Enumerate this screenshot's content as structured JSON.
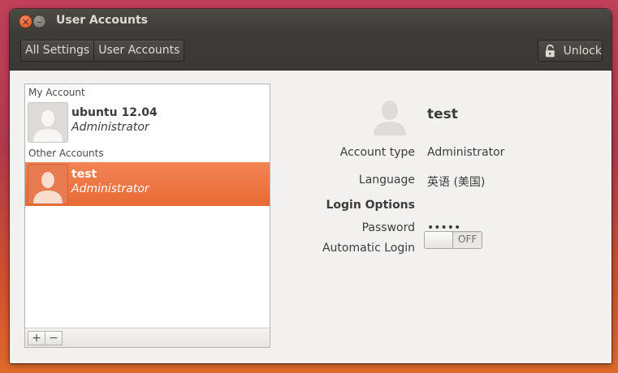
{
  "window": {
    "title": "User Accounts",
    "close_glyph": "×",
    "minimize_glyph": "–"
  },
  "toolbar": {
    "breadcrumbs": [
      {
        "label": "All Settings"
      },
      {
        "label": "User Accounts"
      }
    ],
    "unlock_label": "Unlock",
    "unlock_icon": "padlock-open-icon"
  },
  "sidebar": {
    "my_account_label": "My Account",
    "other_accounts_label": "Other Accounts",
    "accounts": [
      {
        "name": "ubuntu 12.04",
        "role": "Administrator",
        "selected": false
      },
      {
        "name": "test",
        "role": "Administrator",
        "selected": true
      }
    ],
    "add_glyph": "+",
    "remove_glyph": "−"
  },
  "details": {
    "name": "test",
    "fields": [
      {
        "label": "Account type",
        "value": "Administrator"
      },
      {
        "label": "Language",
        "value": "英语 (美国)"
      }
    ],
    "login_options_label": "Login Options",
    "password_label": "Password",
    "password_value": "•••••",
    "autologin_label": "Automatic Login",
    "autologin_state": "OFF"
  },
  "colors": {
    "selection": "#e96a34",
    "titlebar": "#3d3c38",
    "window_bg": "#f2f1f0"
  }
}
